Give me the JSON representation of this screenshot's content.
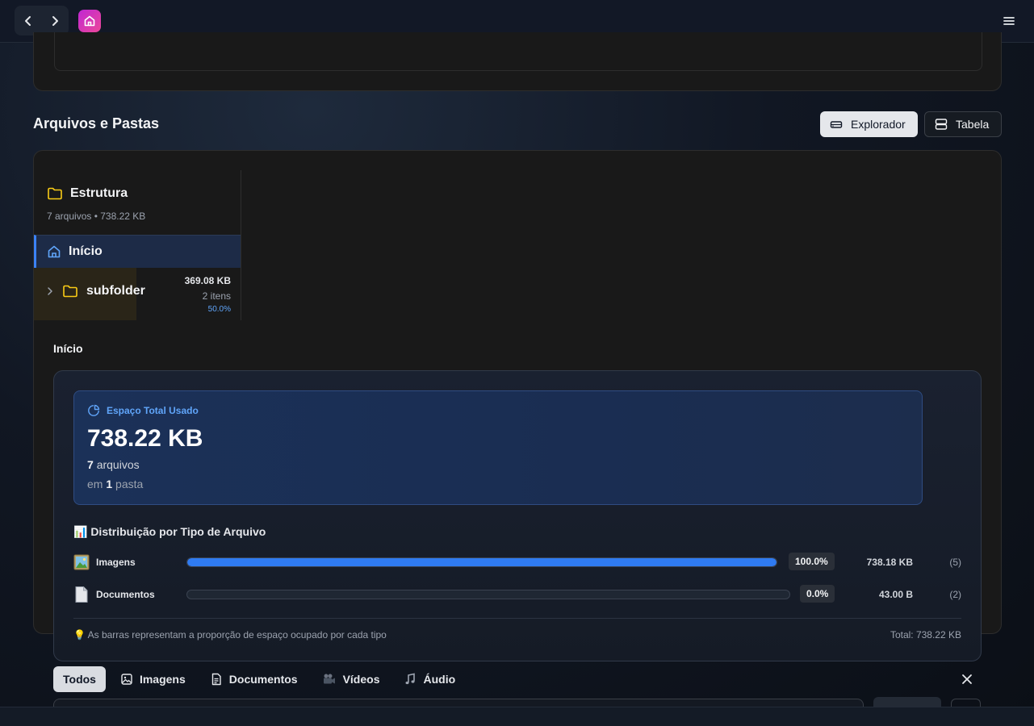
{
  "section": {
    "title": "Arquivos e Pastas",
    "view_explorer": "Explorador",
    "view_table": "Tabela"
  },
  "tree": {
    "title": "Estrutura",
    "meta": "7 arquivos • 738.22 KB",
    "home_label": "Início",
    "subfolder": {
      "name": "subfolder",
      "size": "369.08 KB",
      "count": "2 itens",
      "percent": "50.0%"
    }
  },
  "current_folder": "Início",
  "stats": {
    "total_label": "Espaço Total Usado",
    "total_value": "738.22 KB",
    "files_count": "7",
    "files_word": "arquivos",
    "folders_prefix": "em",
    "folders_count": "1",
    "folders_word": "pasta",
    "distribution_title": "📊 Distribuição por Tipo de Arquivo",
    "rows": [
      {
        "icon": "image-file-icon",
        "name": "Imagens",
        "percent": "100.0%",
        "fill": 1.0,
        "size": "738.18 KB",
        "count": "(5)"
      },
      {
        "icon": "document-file-icon",
        "name": "Documentos",
        "percent": "0.0%",
        "fill": 0.0,
        "size": "43.00 B",
        "count": "(2)"
      }
    ],
    "hint": "💡 As barras representam a proporção de espaço ocupado por cada tipo",
    "footer_total": "Total: 738.22 KB"
  },
  "filters": {
    "all": "Todos",
    "images": "Imagens",
    "documents": "Documentos",
    "videos": "Vídeos",
    "audio": "Áudio"
  },
  "colors": {
    "accent": "#3b82f6",
    "folder": "#facc15",
    "app_icon": "#d946ef"
  }
}
